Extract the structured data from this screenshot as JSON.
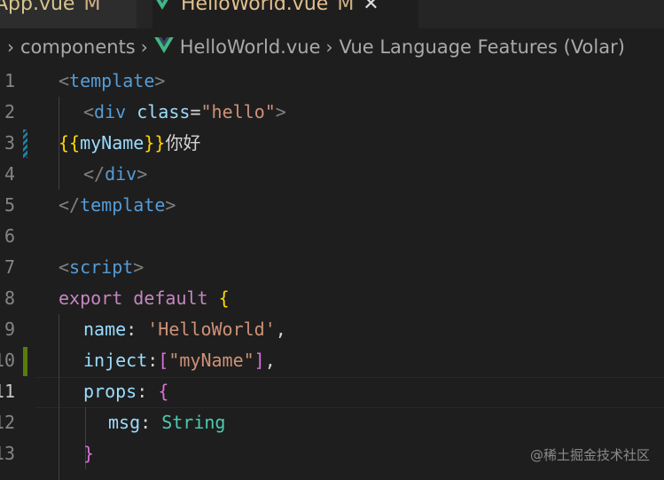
{
  "tabs": [
    {
      "name": "App.vue",
      "status": "M"
    },
    {
      "name": "HelloWorld.vue",
      "status": "M"
    }
  ],
  "breadcrumb": {
    "folder": "components",
    "file": "HelloWorld.vue",
    "symbol": "Vue Language Features (Volar)"
  },
  "line_numbers": [
    "1",
    "2",
    "3",
    "4",
    "5",
    "6",
    "7",
    "8",
    "9",
    "10",
    "11",
    "12",
    "13"
  ],
  "code": {
    "l1": {
      "lt": "<",
      "tag": "template",
      "gt": ">"
    },
    "l2": {
      "lt": "<",
      "tag": "div",
      "sp": " ",
      "attr": "class",
      "eq": "=",
      "str": "\"hello\"",
      "gt": ">"
    },
    "l3": {
      "open": "{{",
      "expr": "myName",
      "close": "}}",
      "text": "你好"
    },
    "l4": {
      "lt": "</",
      "tag": "div",
      "gt": ">"
    },
    "l5": {
      "lt": "</",
      "tag": "template",
      "gt": ">"
    },
    "l7": {
      "lt": "<",
      "tag": "script",
      "gt": ">"
    },
    "l8": {
      "kw": "export default",
      "sp": " ",
      "brace": "{"
    },
    "l9": {
      "prop": "name",
      "colon": ": ",
      "str": "'HelloWorld'",
      "comma": ","
    },
    "l10": {
      "prop": "inject",
      "colon": ":",
      "bopen": "[",
      "str": "\"myName\"",
      "bclose": "]",
      "comma": ","
    },
    "l11": {
      "prop": "props",
      "colon": ": ",
      "brace": "{"
    },
    "l12": {
      "prop": "msg",
      "colon": ": ",
      "type": "String"
    },
    "l13": {
      "brace": "}"
    }
  },
  "watermark": "@稀土掘金技术社区",
  "colors": {
    "vue_green": "#41b883",
    "modified": "#e2c08d",
    "git_added": "#587c0c",
    "git_modified": "#1b81a8"
  }
}
